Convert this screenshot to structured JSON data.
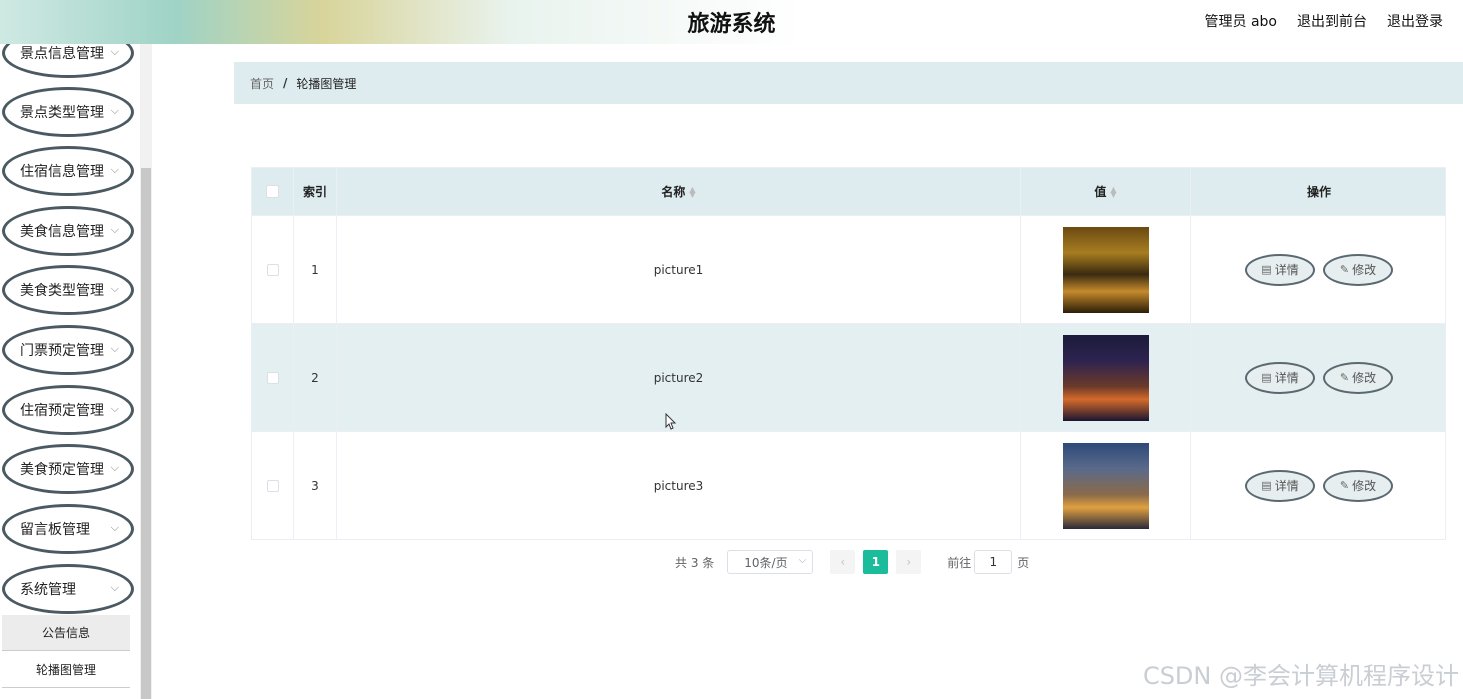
{
  "header": {
    "title": "旅游系统",
    "user": "管理员 abo",
    "back_front": "退出到前台",
    "logout": "退出登录"
  },
  "sidebar": {
    "items": [
      {
        "label": "景点信息管理"
      },
      {
        "label": "景点类型管理"
      },
      {
        "label": "住宿信息管理"
      },
      {
        "label": "美食信息管理"
      },
      {
        "label": "美食类型管理"
      },
      {
        "label": "门票预定管理"
      },
      {
        "label": "住宿预定管理"
      },
      {
        "label": "美食预定管理"
      },
      {
        "label": "留言板管理"
      },
      {
        "label": "系统管理"
      }
    ],
    "sub_items": [
      {
        "label": "公告信息"
      },
      {
        "label": "轮播图管理"
      }
    ]
  },
  "breadcrumb": {
    "home": "首页",
    "separator": "/",
    "current": "轮播图管理"
  },
  "table": {
    "headers": {
      "index": "索引",
      "name": "名称",
      "value": "值",
      "actions": "操作"
    },
    "rows": [
      {
        "index": "1",
        "name": "picture1"
      },
      {
        "index": "2",
        "name": "picture2"
      },
      {
        "index": "3",
        "name": "picture3"
      }
    ],
    "detail_label": "详情",
    "edit_label": "修改"
  },
  "pagination": {
    "total": "共 3 条",
    "page_size": "10条/页",
    "current_page": "1",
    "goto_label": "前往",
    "goto_value": "1",
    "page_suffix": "页"
  },
  "watermark": "CSDN @李会计算机程序设计",
  "colors": {
    "accent": "#1abc9c",
    "header_row": "#deecef"
  }
}
